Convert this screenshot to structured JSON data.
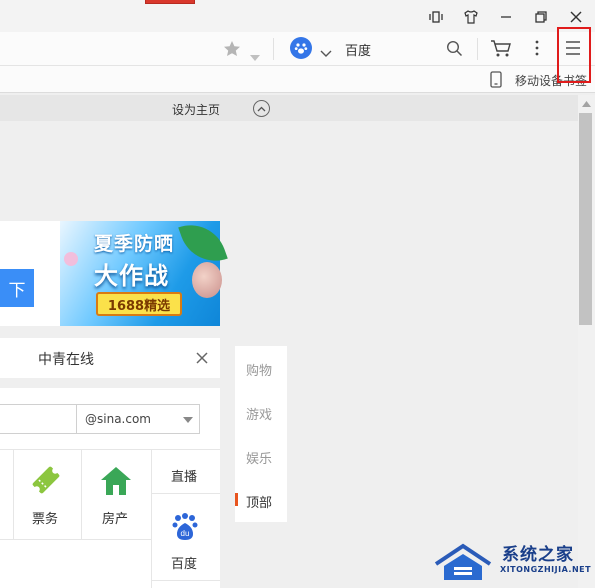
{
  "toolbar": {
    "search_engine": "百度",
    "mobile_bookmark": "移动设备书签"
  },
  "page": {
    "set_homepage": "设为主页",
    "download_button": "下",
    "ad": {
      "title_line1": "夏季防晒",
      "title_line2": "大作战",
      "tag": "1688精选"
    },
    "news": "中青在线",
    "mail_domain": "@sina.com",
    "services": {
      "tickets": "票务",
      "realestate": "房产",
      "live": "直播",
      "baidu": "百度"
    },
    "side_tabs": [
      "购物",
      "游戏",
      "娱乐",
      "顶部"
    ]
  },
  "watermark": {
    "brand": "系统之家",
    "domain": "XITONGZHIJIA.NET"
  },
  "colors": {
    "highlight": "#e01b1b",
    "accent_blue": "#3a8ef7",
    "side_marker": "#e8551f"
  }
}
